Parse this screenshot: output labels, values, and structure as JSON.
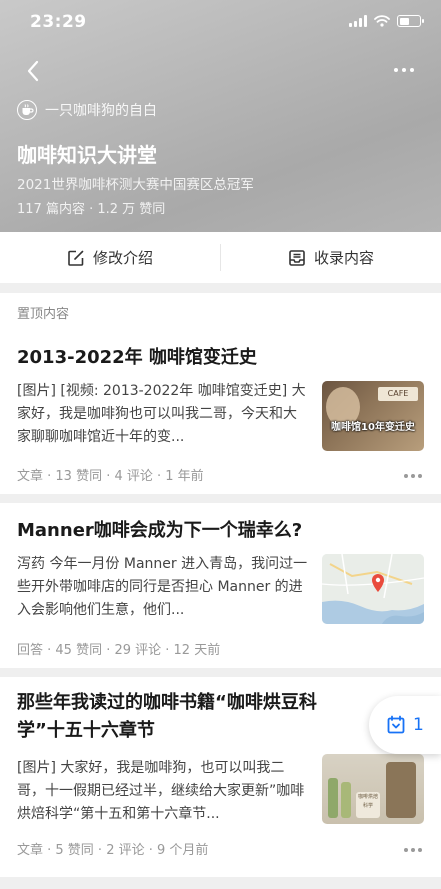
{
  "status_bar": {
    "time": "23:29"
  },
  "column": {
    "author": "一只咖啡狗的自白",
    "title": "咖啡知识大讲堂",
    "description": "2021世界咖啡杯测大赛中国赛区总冠军",
    "stats": "117 篇内容 · 1.2 万 赞同"
  },
  "actions": {
    "edit_label": "修改介绍",
    "collect_label": "收录内容"
  },
  "section": {
    "pinned_label": "置顶内容"
  },
  "items": [
    {
      "title": "2013-2022年 咖啡馆变迁史",
      "body": "[图片] [视频: 2013-2022年 咖啡馆变迁史] 大家好，我是咖啡狗也可以叫我二哥，今天和大家聊聊咖啡馆近十年的变...",
      "meta": "文章 · 13 赞同 · 4 评论 · 1 年前",
      "thumb_label": "咖啡馆10年变迁史",
      "thumb_tag": "CAFE"
    },
    {
      "title": "Manner咖啡会成为下一个瑞幸么?",
      "body": "泻药 今年一月份 Manner 进入青岛，我问过一些开外带咖啡店的同行是否担心 Manner 的进入会影响他们生意，他们...",
      "meta": "回答 · 45 赞同 · 29 评论 · 12 天前"
    },
    {
      "title": "那些年我读过的咖啡书籍“咖啡烘豆科学”十五十六章节",
      "body": "[图片] 大家好，我是咖啡狗，也可以叫我二哥，十一假期已经过半，继续给大家更新”咖啡烘焙科学“第十五和第十六章节...",
      "meta": "文章 · 5 赞同 · 2 评论 · 9 个月前",
      "thumb_label": "咖啡烘焙科学"
    }
  ],
  "floating": {
    "count": "1"
  },
  "colors": {
    "accent": "#1772f6",
    "header_bg": "#b5b5b5",
    "meta_text": "#999999"
  }
}
